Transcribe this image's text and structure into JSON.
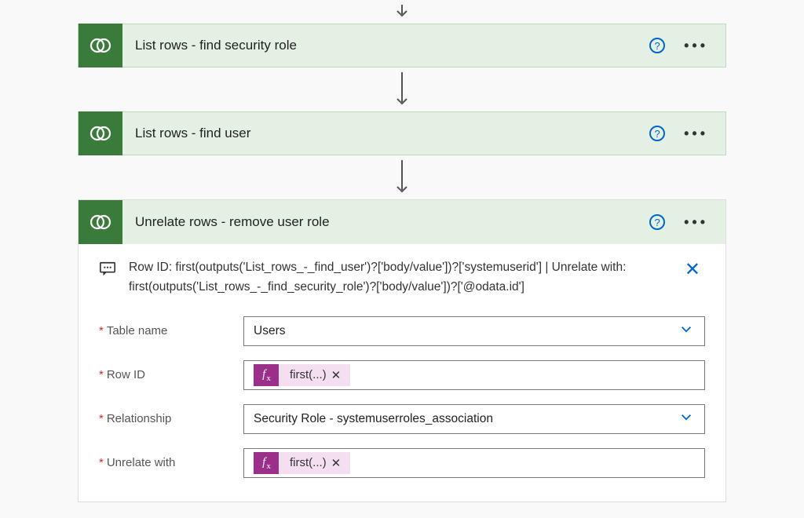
{
  "steps": [
    {
      "title": "List rows - find security role"
    },
    {
      "title": "List rows - find user"
    },
    {
      "title": "Unrelate rows - remove user role"
    }
  ],
  "peek": {
    "text": "Row ID: first(outputs('List_rows_-_find_user')?['body/value'])?['systemuserid'] | Unrelate with: first(outputs('List_rows_-_find_security_role')?['body/value'])?['@odata.id']"
  },
  "form": {
    "tableName": {
      "label": "Table name",
      "value": "Users"
    },
    "rowId": {
      "label": "Row ID",
      "token": "first(...)"
    },
    "relationship": {
      "label": "Relationship",
      "value": "Security Role - systemuserroles_association"
    },
    "unrelateWith": {
      "label": "Unrelate with",
      "token": "first(...)"
    }
  },
  "glyphs": {
    "help": "?",
    "ellipsis": "•••",
    "close": "✕",
    "tokenRemove": "✕",
    "fx": "f"
  }
}
